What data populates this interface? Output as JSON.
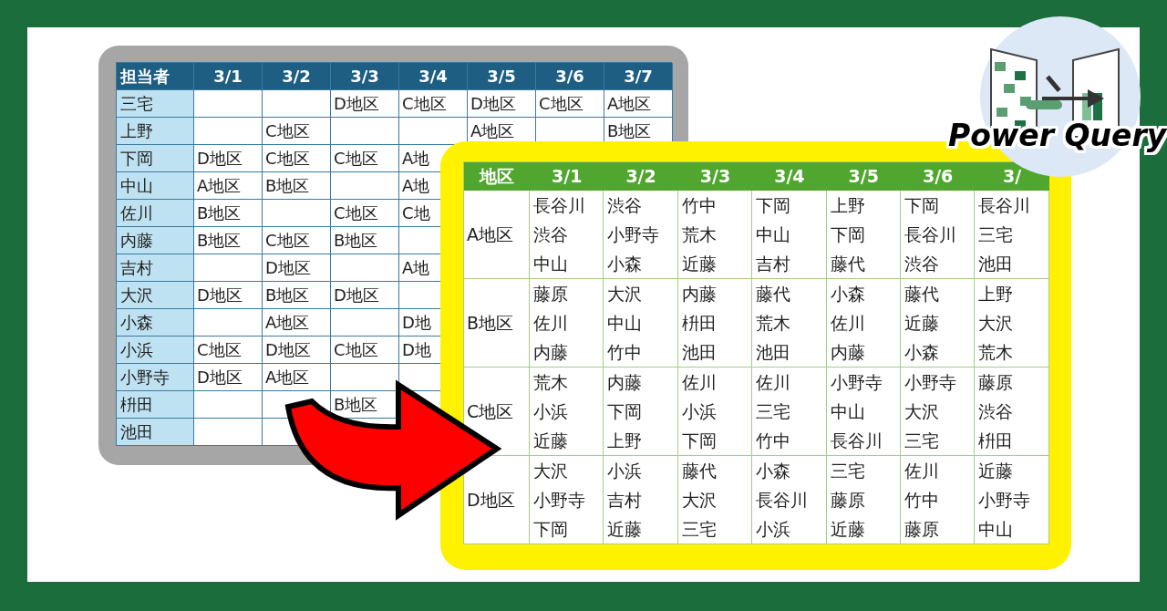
{
  "schedule_by_person": {
    "columns": [
      "担当者",
      "3/1",
      "3/2",
      "3/3",
      "3/4",
      "3/5",
      "3/6",
      "3/7"
    ],
    "rows": [
      [
        "三宅",
        "",
        "",
        "D地区",
        "C地区",
        "D地区",
        "C地区",
        "A地区"
      ],
      [
        "上野",
        "",
        "C地区",
        "",
        "",
        "A地区",
        "",
        "B地区"
      ],
      [
        "下岡",
        "D地区",
        "C地区",
        "C地区",
        "A地"
      ],
      [
        "中山",
        "A地区",
        "B地区",
        "",
        "A地"
      ],
      [
        "佐川",
        "B地区",
        "",
        "C地区",
        "C地"
      ],
      [
        "内藤",
        "B地区",
        "C地区",
        "B地区",
        ""
      ],
      [
        "吉村",
        "",
        "D地区",
        "",
        "A地"
      ],
      [
        "大沢",
        "D地区",
        "B地区",
        "D地区",
        ""
      ],
      [
        "小森",
        "",
        "A地区",
        "",
        "D地"
      ],
      [
        "小浜",
        "C地区",
        "D地区",
        "C地区",
        "D地"
      ],
      [
        "小野寺",
        "D地区",
        "A地区",
        "",
        ""
      ],
      [
        "枡田",
        "",
        "",
        "B地区"
      ],
      [
        "池田",
        "",
        ""
      ]
    ]
  },
  "schedule_by_area": {
    "columns": [
      "地区",
      "3/1",
      "3/2",
      "3/3",
      "3/4",
      "3/5",
      "3/6",
      "3/"
    ],
    "rows": [
      {
        "area": "A地区",
        "days": [
          [
            "長谷川",
            "渋谷",
            "中山"
          ],
          [
            "渋谷",
            "小野寺",
            "小森"
          ],
          [
            "竹中",
            "荒木",
            "近藤"
          ],
          [
            "下岡",
            "中山",
            "吉村"
          ],
          [
            "上野",
            "下岡",
            "藤代"
          ],
          [
            "下岡",
            "長谷川",
            "渋谷"
          ],
          [
            "長谷川",
            "三宅",
            "池田"
          ]
        ]
      },
      {
        "area": "B地区",
        "days": [
          [
            "藤原",
            "佐川",
            "内藤"
          ],
          [
            "大沢",
            "中山",
            "竹中"
          ],
          [
            "内藤",
            "枡田",
            "池田"
          ],
          [
            "藤代",
            "荒木",
            "池田"
          ],
          [
            "小森",
            "佐川",
            "内藤"
          ],
          [
            "藤代",
            "近藤",
            "小森"
          ],
          [
            "上野",
            "大沢",
            "荒木"
          ]
        ]
      },
      {
        "area": "C地区",
        "days": [
          [
            "荒木",
            "小浜",
            "近藤"
          ],
          [
            "内藤",
            "下岡",
            "上野"
          ],
          [
            "佐川",
            "小浜",
            "下岡"
          ],
          [
            "佐川",
            "三宅",
            "竹中"
          ],
          [
            "小野寺",
            "中山",
            "長谷川"
          ],
          [
            "小野寺",
            "大沢",
            "三宅"
          ],
          [
            "藤原",
            "渋谷",
            "枡田"
          ]
        ]
      },
      {
        "area": "D地区",
        "days": [
          [
            "大沢",
            "小野寺",
            "下岡"
          ],
          [
            "小浜",
            "吉村",
            "近藤"
          ],
          [
            "藤代",
            "大沢",
            "三宅"
          ],
          [
            "小森",
            "長谷川",
            "小浜"
          ],
          [
            "三宅",
            "藤原",
            "近藤"
          ],
          [
            "佐川",
            "竹中",
            "藤原"
          ],
          [
            "近藤",
            "小野寺",
            "中山"
          ]
        ]
      }
    ]
  },
  "logo": {
    "title": "Power Query"
  }
}
